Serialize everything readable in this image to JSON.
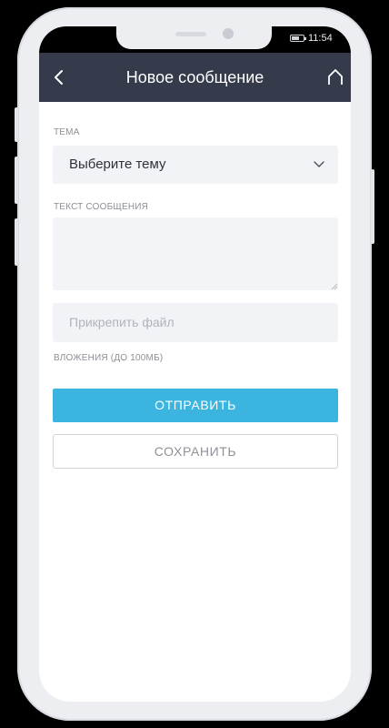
{
  "status_bar": {
    "time": "11:54"
  },
  "header": {
    "title": "Новое сообщение",
    "back_icon": "chevron-left-icon",
    "home_icon": "home-icon",
    "background": "#353b4a"
  },
  "form": {
    "topic_label": "ТЕМА",
    "topic_value": "Выберите тему",
    "message_label": "ТЕКСТ СООБЩЕНИЯ",
    "message_value": "",
    "attach_placeholder": "Прикрепить файл",
    "attachments_label": "ВЛОЖЕНИЯ (ДО 100МБ)"
  },
  "actions": {
    "send_label": "ОТПРАВИТЬ",
    "save_label": "СОХРАНИТЬ",
    "accent_color": "#3bb4e0"
  }
}
